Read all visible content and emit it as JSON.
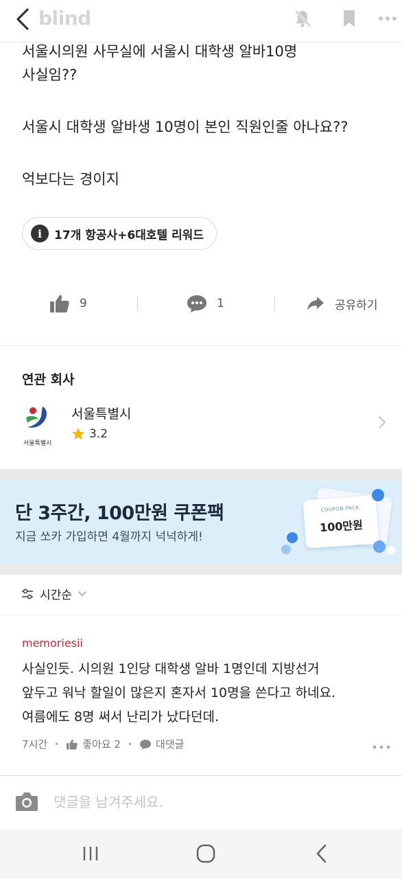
{
  "topbar": {
    "logo": "blind",
    "icons": [
      "back-chevron-icon",
      "bell-off-icon",
      "bookmark-icon",
      "more-horizontal-icon"
    ]
  },
  "post": {
    "lines": [
      "서울시의원 사무실에 서울시 대학생 알바10명",
      "사실임??",
      "서울시 대학생 알바생 10명이 본인 직원인줄 아나요??",
      "억보다는 경이지"
    ],
    "promo_pill": "17개 항공사+6대호텔 리워드"
  },
  "actions": {
    "like_count": "9",
    "comment_count": "1",
    "share_label": "공유하기"
  },
  "related": {
    "title": "연관 회사",
    "company_name": "서울특별시",
    "logo_caption": "서울특별시",
    "rating": "3.2",
    "star_color": "#f5b800"
  },
  "ad": {
    "title": "단 3주간, 100만원 쿠폰팩",
    "subtitle": "지금 쏘카 가입하면 4월까지 넉넉하게!",
    "coupon_small": "COUPON PACK",
    "coupon_big": "100만원",
    "bg_color": "#ddeefb"
  },
  "sort": {
    "label": "시간순"
  },
  "comment": {
    "username": "memoriesii",
    "username_color": "#c8283c",
    "lines": [
      "사실인듯. 시의원 1인당 대학생 알바 1명인데 지방선거",
      "앞두고  워낙 할일이 많은지 혼자서 10명을 쓴다고 하네요.",
      "여름에도 8명 써서 난리가 났다던데."
    ],
    "time": "7시간",
    "like_label": "좋아요 2",
    "reply_label": "대댓글"
  },
  "input": {
    "placeholder": "댓글을 남겨주세요."
  }
}
